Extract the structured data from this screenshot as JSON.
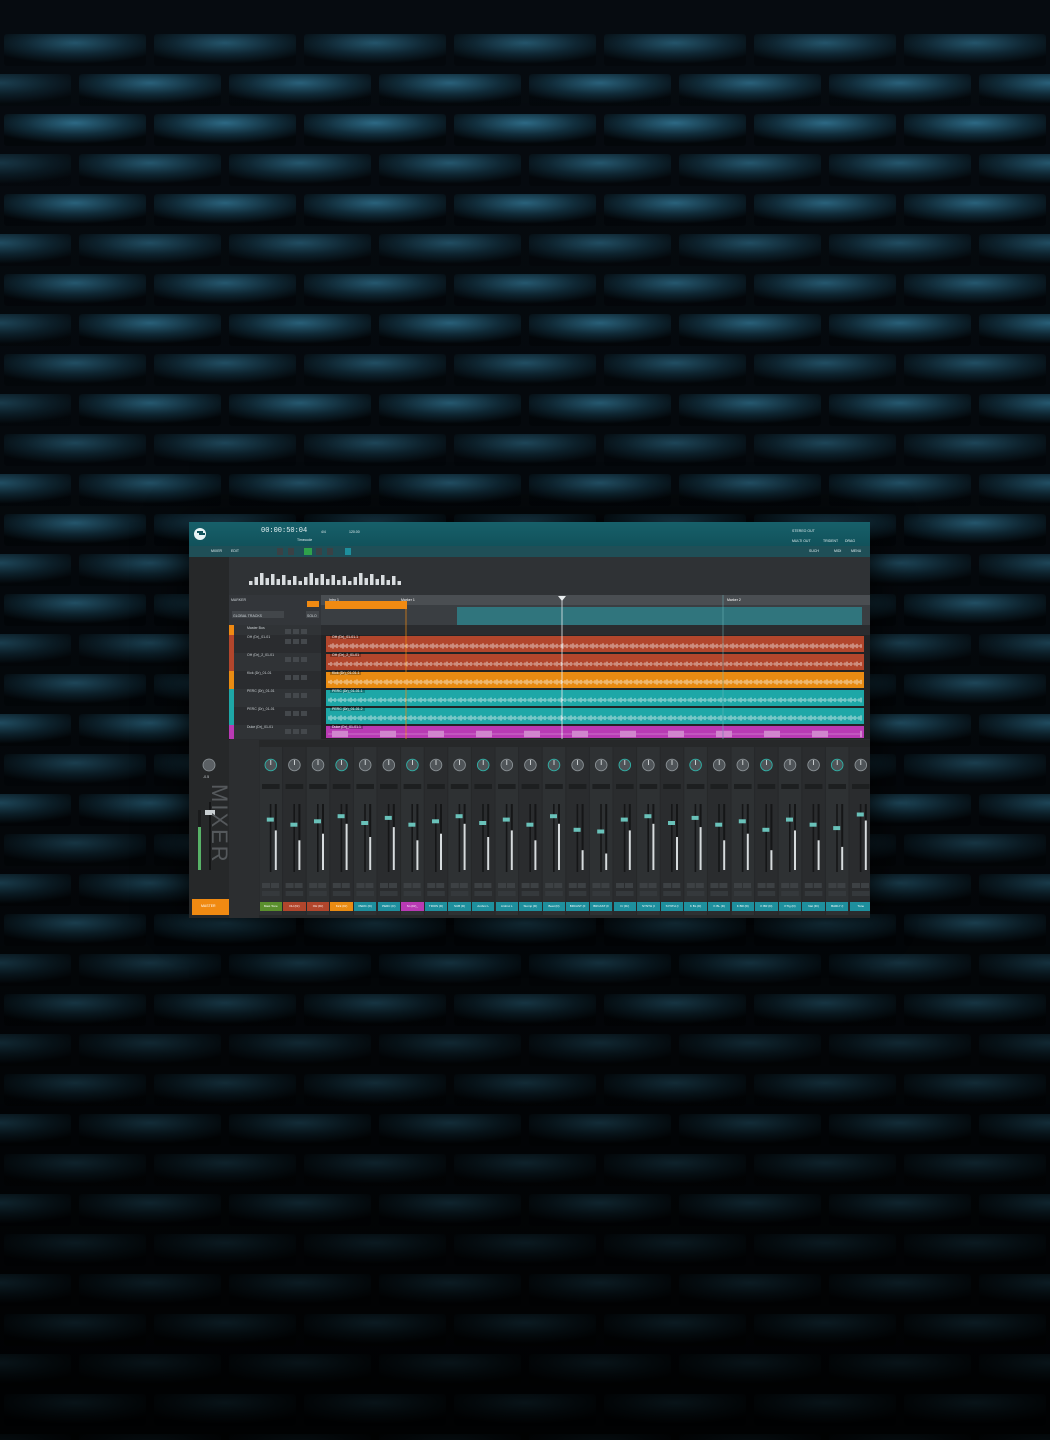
{
  "app": {
    "transport_time": "00:00:50:04",
    "transport_labels": [
      "Timecode",
      "4/4",
      "120.00"
    ],
    "toolbar_left": [
      "MIXER",
      "EDIT"
    ],
    "toolbar_right": [
      "SUCH",
      "MIDI",
      "MENU"
    ],
    "top_right": [
      "STEREO OUT",
      "MULTI OUT",
      "TRIDENT",
      "DRAG"
    ]
  },
  "arrange": {
    "header_left": [
      "MARKER",
      "GLOBAL TRACKS",
      "SOLO"
    ],
    "markers": [
      "Intro 1",
      "Marker 1",
      "Marker 2"
    ],
    "tracks": [
      {
        "name": "Master Bus",
        "clip": "",
        "color": "#f08a12"
      },
      {
        "name": "OH (Dr)_01-01",
        "clip": "OH (Dr)_01-01.1",
        "color": "#b2462c"
      },
      {
        "name": "OH (Dr)_2_01-01",
        "clip": "OH (Dr)_2_01-01",
        "color": "#b2462c"
      },
      {
        "name": "Kick (Dr)_01-01",
        "clip": "Kick (Dr)_01-01.1",
        "color": "#e98b12"
      },
      {
        "name": "PERC (Dr)_01-01",
        "clip": "PERC (Dr)_01-01.1",
        "color": "#1ea7a7"
      },
      {
        "name": "PERC (Dr)_01-01",
        "clip": "PERC (Dr)_01-01.2",
        "color": "#1ea7a7"
      },
      {
        "name": "Duke (Dr)_01-01",
        "clip": "Duke (Dr)_01-01.1",
        "color": "#b93ab4"
      }
    ]
  },
  "mixer": {
    "title": "MIXER",
    "master_label": "MASTER",
    "master_value": "-0.5",
    "channels": [
      {
        "name": "Mast Tone",
        "color": "#5a8f2d"
      },
      {
        "name": "OH (Dr)",
        "color": "#b2462c"
      },
      {
        "name": "OH (Dr)",
        "color": "#b2462c"
      },
      {
        "name": "Kick (Dr)",
        "color": "#e98b12"
      },
      {
        "name": "PERC (D)",
        "color": "#1e8f9d"
      },
      {
        "name": "PERC (D)",
        "color": "#1e8f9d"
      },
      {
        "name": "Sn (Dr)_",
        "color": "#b93ab4"
      },
      {
        "name": "TRIOS (D)",
        "color": "#1e8f9d"
      },
      {
        "name": "SUB (D)",
        "color": "#1e8f9d"
      },
      {
        "name": "Ambnc L",
        "color": "#1e8f9d"
      },
      {
        "name": "Ambnc L",
        "color": "#1e8f9d"
      },
      {
        "name": "Stomp (D)",
        "color": "#1e8f9d"
      },
      {
        "name": "Beat (D)",
        "color": "#1e8f9d"
      },
      {
        "name": "BRCAST (F",
        "color": "#1e8f9d"
      },
      {
        "name": "BRCAST (F",
        "color": "#1e8f9d"
      },
      {
        "name": "Fr (Dr)",
        "color": "#1e8f9d"
      },
      {
        "name": "SYNTH (I",
        "color": "#1e8f9d"
      },
      {
        "name": "SYNTH (I",
        "color": "#1e8f9d"
      },
      {
        "name": "K BL (D)",
        "color": "#1e8f9d"
      },
      {
        "name": "K BL (D)",
        "color": "#1e8f9d"
      },
      {
        "name": "K BR (D)",
        "color": "#1e8f9d"
      },
      {
        "name": "K BR (D)",
        "color": "#1e8f9d"
      },
      {
        "name": "KTIg (D)",
        "color": "#1e8f9d"
      },
      {
        "name": "Nat (Dr)",
        "color": "#1e8f9d"
      },
      {
        "name": "BARLY (I",
        "color": "#1e8f9d"
      },
      {
        "name": "Tone",
        "color": "#1e8f9d"
      }
    ]
  }
}
